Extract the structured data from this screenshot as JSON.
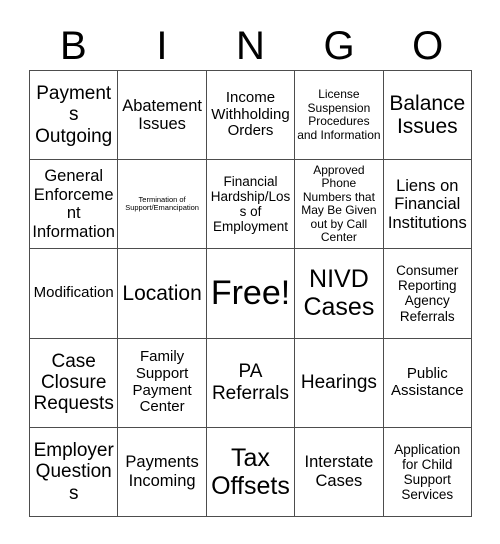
{
  "card": {
    "title": "BINGO",
    "header_letters": [
      "B",
      "I",
      "N",
      "G",
      "O"
    ],
    "grid_size": "5x5",
    "colors": {
      "background": "#ffffff",
      "text": "#000000",
      "border": "#4d4d4d"
    },
    "rows": [
      [
        {
          "text": "Payments Outgoing",
          "size": "fs-l"
        },
        {
          "text": "Abatement Issues",
          "size": "fs-ml"
        },
        {
          "text": "Income Withholding Orders",
          "size": "fs-m"
        },
        {
          "text": "License Suspension Procedures and Information",
          "size": "fs-xs"
        },
        {
          "text": "Balance Issues",
          "size": "fs-xl"
        }
      ],
      [
        {
          "text": "General Enforcement Information",
          "size": "fs-ml"
        },
        {
          "text": "Termination of Support/Emancipation",
          "size": "fs-xxs"
        },
        {
          "text": "Financial Hardship/Loss of Employment",
          "size": "fs-s"
        },
        {
          "text": "Approved Phone Numbers that May Be Given out by Call Center",
          "size": "fs-xs"
        },
        {
          "text": "Liens on Financial Institutions",
          "size": "fs-ml"
        }
      ],
      [
        {
          "text": "Modification",
          "size": "fs-m"
        },
        {
          "text": "Location",
          "size": "fs-xl"
        },
        {
          "text": "Free!",
          "size": "fs-huge"
        },
        {
          "text": "NIVD Cases",
          "size": "fs-xxl"
        },
        {
          "text": "Consumer Reporting Agency Referrals",
          "size": "fs-s"
        }
      ],
      [
        {
          "text": "Case Closure Requests",
          "size": "fs-l"
        },
        {
          "text": "Family Support Payment Center",
          "size": "fs-m"
        },
        {
          "text": "PA Referrals",
          "size": "fs-l"
        },
        {
          "text": "Hearings",
          "size": "fs-l"
        },
        {
          "text": "Public Assistance",
          "size": "fs-m"
        }
      ],
      [
        {
          "text": "Employer Questions",
          "size": "fs-l"
        },
        {
          "text": "Payments Incoming",
          "size": "fs-ml"
        },
        {
          "text": "Tax Offsets",
          "size": "fs-xxl"
        },
        {
          "text": "Interstate Cases",
          "size": "fs-ml"
        },
        {
          "text": "Application for Child Support Services",
          "size": "fs-s"
        }
      ]
    ]
  }
}
